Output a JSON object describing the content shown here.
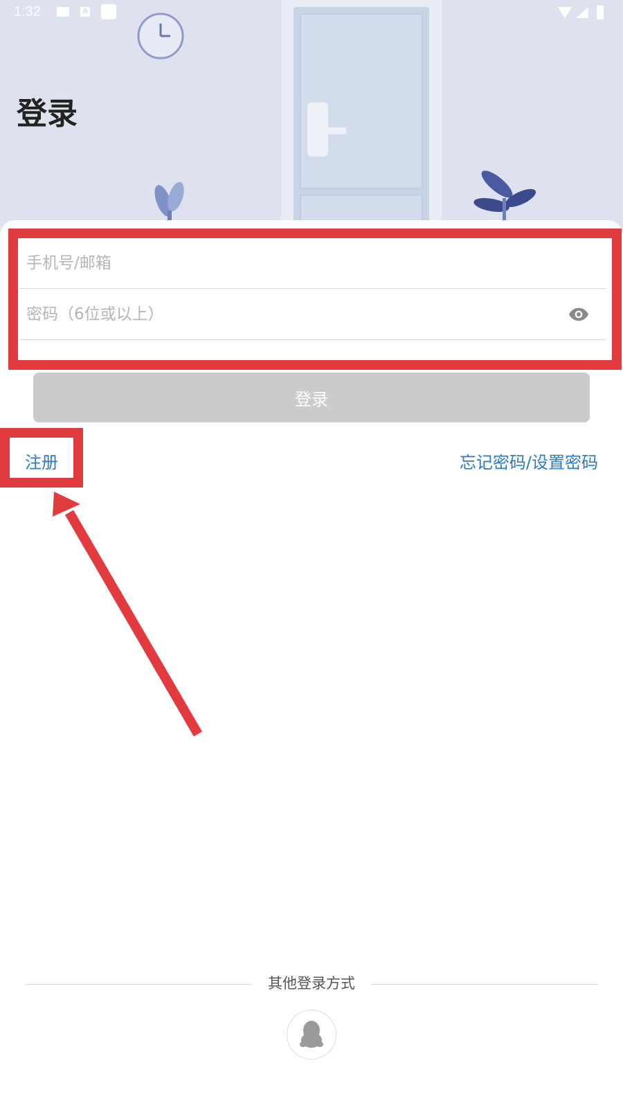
{
  "status_bar": {
    "time": "1:32",
    "a_glyph": "A"
  },
  "header": {
    "title": "登录"
  },
  "form": {
    "phone_placeholder": "手机号/邮箱",
    "password_placeholder": "密码（6位或以上）",
    "login_label": "登录"
  },
  "links": {
    "register": "注册",
    "forgot": "忘记密码/设置密码"
  },
  "other_login": {
    "label": "其他登录方式",
    "icons": [
      "qq-icon"
    ]
  },
  "colors": {
    "accent_link": "#2b7bc1",
    "annotation_red": "#e23b3f",
    "disabled_button": "#cbcbcb",
    "hero_background": "#dde2ee"
  }
}
